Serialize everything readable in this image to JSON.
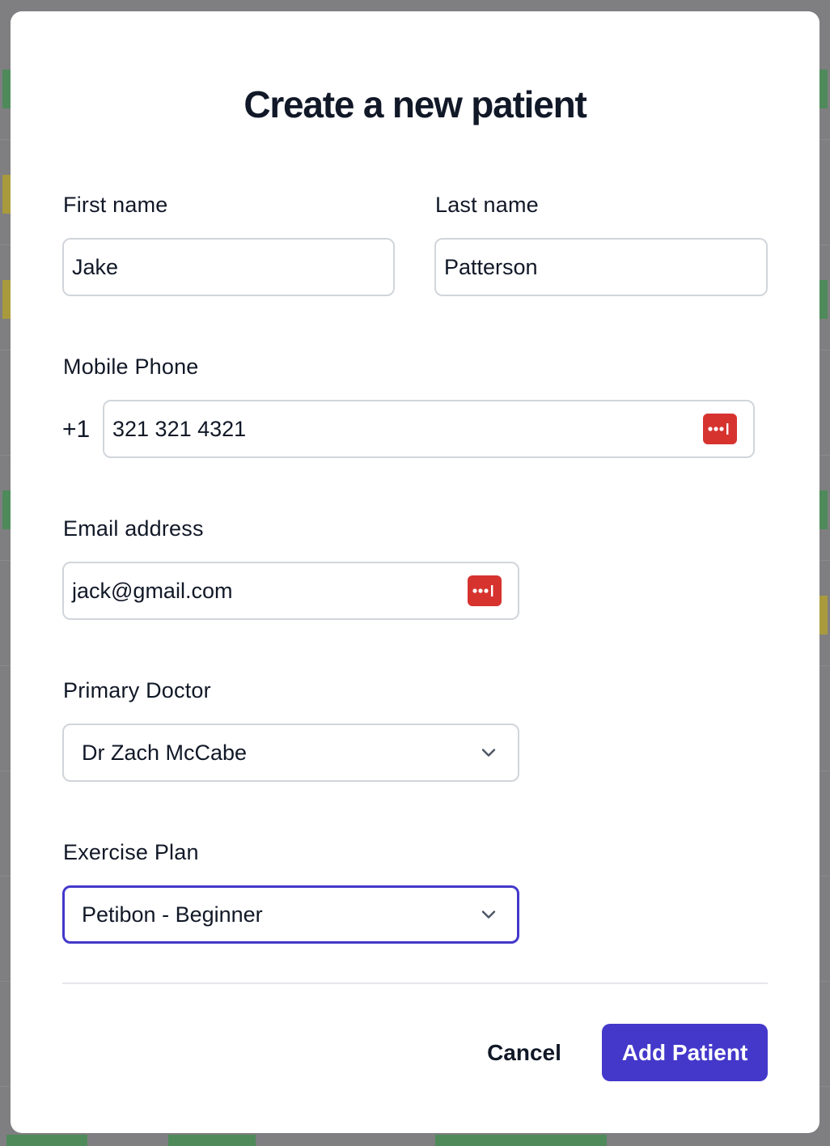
{
  "modal": {
    "title": "Create a new patient",
    "first_name": {
      "label": "First name",
      "value": "Jake"
    },
    "last_name": {
      "label": "Last name",
      "value": "Patterson"
    },
    "mobile_phone": {
      "label": "Mobile Phone",
      "prefix": "+1",
      "value": "321 321 4321"
    },
    "email": {
      "label": "Email address",
      "value": "jack@gmail.com"
    },
    "primary_doctor": {
      "label": "Primary Doctor",
      "selected": "Dr Zach McCabe"
    },
    "exercise_plan": {
      "label": "Exercise Plan",
      "selected": "Petibon - Beginner"
    },
    "actions": {
      "cancel_label": "Cancel",
      "submit_label": "Add Patient"
    }
  },
  "colors": {
    "accent": "#4338ca",
    "password_manager": "#d6332f",
    "text": "#111827",
    "overlay": "#7f7f81"
  },
  "icons": {
    "password_manager": "password-manager-icon",
    "dropdown": "chevron-down-icon"
  }
}
